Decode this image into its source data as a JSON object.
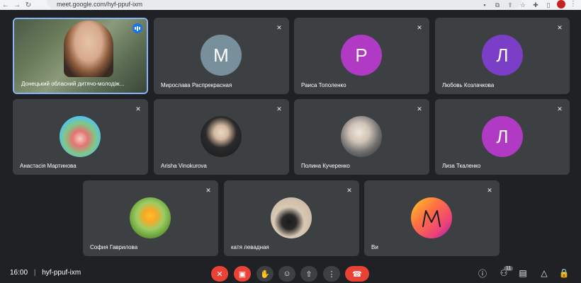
{
  "browser": {
    "url": "meet.google.com/hyf-ppuf-ixm",
    "back_icon": "arrow-left-icon",
    "forward_icon": "arrow-right-icon",
    "reload_icon": "reload-icon"
  },
  "participants": [
    {
      "name": "Донецький обласний дитячо-молодіж...",
      "type": "video",
      "speaking": true
    },
    {
      "name": "Мирослава Распрекрасная",
      "initial": "М",
      "color": "#78909c",
      "muted": true
    },
    {
      "name": "Раиса Тополенко",
      "initial": "Р",
      "color": "#b03ac3",
      "muted": true
    },
    {
      "name": "Любовь Козлачкова",
      "initial": "Л",
      "color": "#7b3fc7",
      "muted": true
    },
    {
      "name": "Анастасія Мартинова",
      "photo": true,
      "muted": true
    },
    {
      "name": "Arisha Vinokurova",
      "photo": true,
      "muted": true
    },
    {
      "name": "Полина Кучеренко",
      "photo": true,
      "muted": true
    },
    {
      "name": "Лиза Ткаленко",
      "initial": "Л",
      "color": "#b03ac3",
      "muted": true
    },
    {
      "name": "София Гаврилова",
      "photo": true,
      "muted": true
    },
    {
      "name": "катя левадная",
      "photo": true,
      "muted": true
    },
    {
      "name": "Ви",
      "photo": true,
      "muted": true
    }
  ],
  "bottom_bar": {
    "time": "16:00",
    "separator": "|",
    "meeting_code": "hyf-ppuf-ixm",
    "participant_count": "11"
  }
}
